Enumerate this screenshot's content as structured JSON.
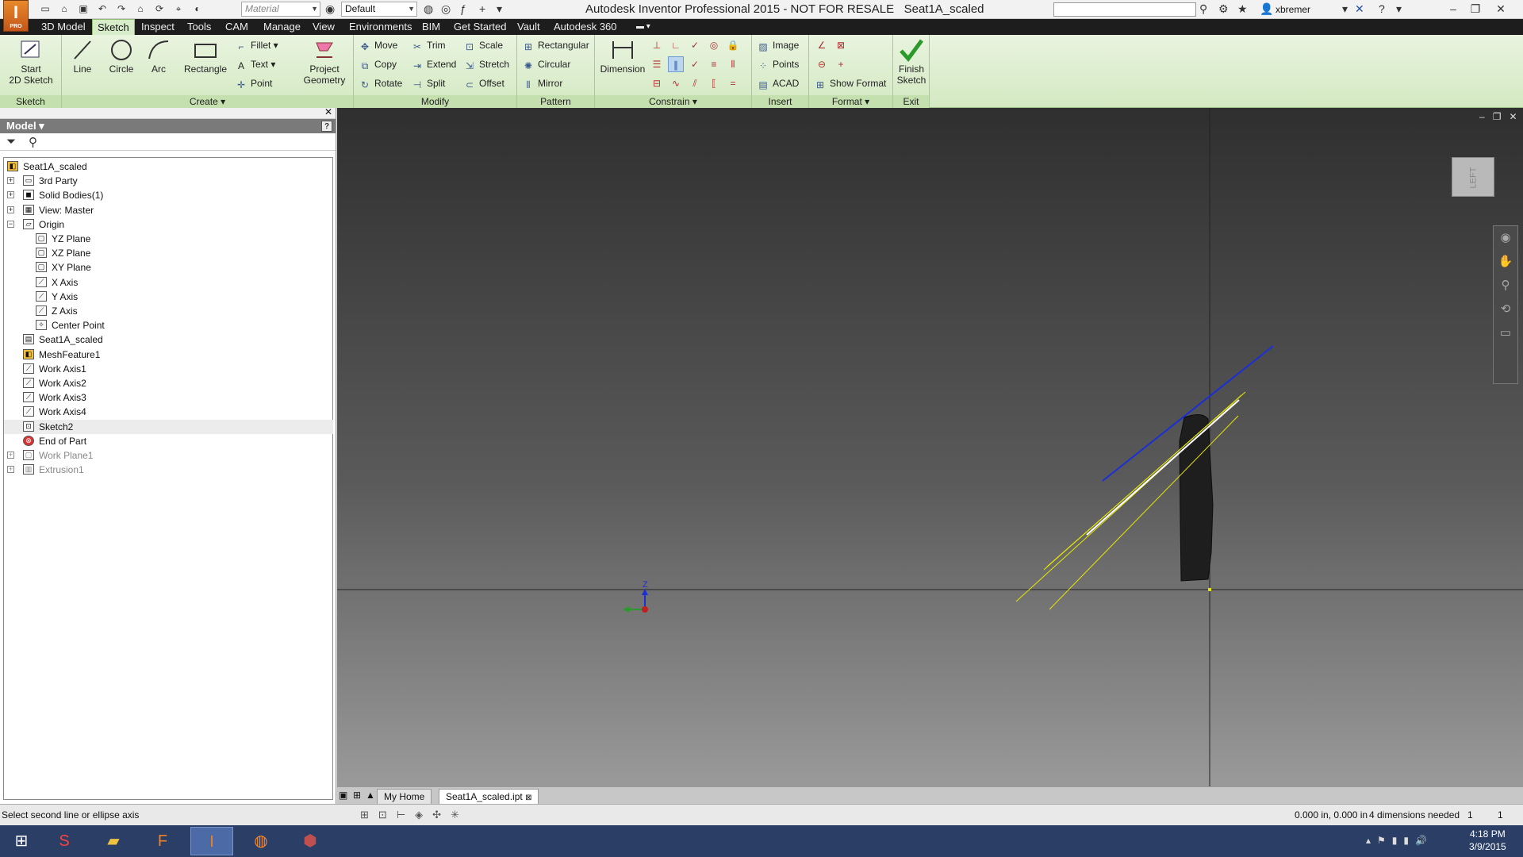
{
  "app": {
    "logo_letter": "I",
    "logo_sub": "PRO",
    "title": "Autodesk Inventor Professional 2015 - NOT FOR RESALE",
    "document": "Seat1A_scaled",
    "material_placeholder": "Material",
    "appearance_value": "Default",
    "user": "xbremer"
  },
  "tabs": [
    "3D Model",
    "Sketch",
    "Inspect",
    "Tools",
    "CAM",
    "Manage",
    "View",
    "Environments",
    "BIM",
    "Get Started",
    "Vault",
    "Autodesk 360"
  ],
  "ribbon": {
    "sketch_group": {
      "title": "Sketch",
      "start_label": "Start\n2D Sketch"
    },
    "create_group": {
      "title": "Create ▾",
      "line": "Line",
      "circle": "Circle",
      "arc": "Arc",
      "rectangle": "Rectangle",
      "fillet": "Fillet",
      "text": "Text",
      "point": "Point",
      "project_geometry": "Project\nGeometry"
    },
    "modify_group": {
      "title": "Modify",
      "move": "Move",
      "trim": "Trim",
      "scale": "Scale",
      "copy": "Copy",
      "extend": "Extend",
      "stretch": "Stretch",
      "rotate": "Rotate",
      "split": "Split",
      "offset": "Offset"
    },
    "pattern_group": {
      "title": "Pattern",
      "rectangular": "Rectangular",
      "circular": "Circular",
      "mirror": "Mirror"
    },
    "constrain_group": {
      "title": "Constrain ▾",
      "dimension": "Dimension"
    },
    "insert_group": {
      "title": "Insert",
      "image": "Image",
      "points": "Points",
      "acad": "ACAD"
    },
    "format_group": {
      "title": "Format ▾",
      "show_format": "Show Format"
    },
    "exit_group": {
      "title": "Exit",
      "finish_sketch": "Finish\nSketch"
    }
  },
  "browser": {
    "title": "Model ▾",
    "tree": [
      {
        "label": "Seat1A_scaled",
        "icon": "part-icon",
        "level": 0,
        "exp": ""
      },
      {
        "label": "3rd Party",
        "icon": "folder-icon",
        "level": 1,
        "exp": "+"
      },
      {
        "label": "Solid Bodies(1)",
        "icon": "solid-bodies-icon",
        "level": 1,
        "exp": "+"
      },
      {
        "label": "View: Master",
        "icon": "view-icon",
        "level": 1,
        "exp": "+"
      },
      {
        "label": "Origin",
        "icon": "folder-open-icon",
        "level": 1,
        "exp": "-"
      },
      {
        "label": "YZ Plane",
        "icon": "plane-icon",
        "level": 2,
        "exp": ""
      },
      {
        "label": "XZ Plane",
        "icon": "plane-icon",
        "level": 2,
        "exp": ""
      },
      {
        "label": "XY Plane",
        "icon": "plane-icon",
        "level": 2,
        "exp": ""
      },
      {
        "label": "X Axis",
        "icon": "axis-icon",
        "level": 2,
        "exp": ""
      },
      {
        "label": "Y Axis",
        "icon": "axis-icon",
        "level": 2,
        "exp": ""
      },
      {
        "label": "Z Axis",
        "icon": "axis-icon",
        "level": 2,
        "exp": ""
      },
      {
        "label": "Center Point",
        "icon": "center-point-icon",
        "level": 2,
        "exp": ""
      },
      {
        "label": "Seat1A_scaled",
        "icon": "mesh-icon",
        "level": 1,
        "exp": ""
      },
      {
        "label": "MeshFeature1",
        "icon": "mesh-feature-icon",
        "level": 1,
        "exp": ""
      },
      {
        "label": "Work Axis1",
        "icon": "work-axis-icon",
        "level": 1,
        "exp": ""
      },
      {
        "label": "Work Axis2",
        "icon": "work-axis-icon",
        "level": 1,
        "exp": ""
      },
      {
        "label": "Work Axis3",
        "icon": "work-axis-icon",
        "level": 1,
        "exp": ""
      },
      {
        "label": "Work Axis4",
        "icon": "work-axis-icon",
        "level": 1,
        "exp": ""
      },
      {
        "label": "Sketch2",
        "icon": "sketch-icon",
        "level": 1,
        "exp": ""
      },
      {
        "label": "End of Part",
        "icon": "end-of-part-icon",
        "level": 1,
        "exp": ""
      },
      {
        "label": "Work Plane1",
        "icon": "work-plane-icon",
        "level": 1,
        "exp": "+"
      },
      {
        "label": "Extrusion1",
        "icon": "extrusion-icon",
        "level": 1,
        "exp": "+"
      }
    ]
  },
  "viewport": {
    "viewcube_label": "LEFT",
    "axis_z_label": "Z"
  },
  "doc_tabs": [
    "My Home",
    "Seat1A_scaled.ipt"
  ],
  "status": {
    "message": "Select second line or ellipse axis",
    "coords": "0.000 in, 0.000 in",
    "dims_needed": "4 dimensions needed",
    "n1": "1",
    "n2": "1"
  },
  "taskbar": {
    "time": "4:18 PM",
    "date": "3/9/2015",
    "apps": [
      "windows-start-icon",
      "solidworks-icon",
      "file-explorer-icon",
      "fusion360-icon",
      "inventor-icon",
      "firefox-icon",
      "app-icon"
    ]
  },
  "colors": {
    "ribbon_green": "#d3e9c2",
    "sketch_yellow": "#e6e600",
    "axis_blue": "#1a2fd6",
    "line_white": "#ffffff"
  }
}
